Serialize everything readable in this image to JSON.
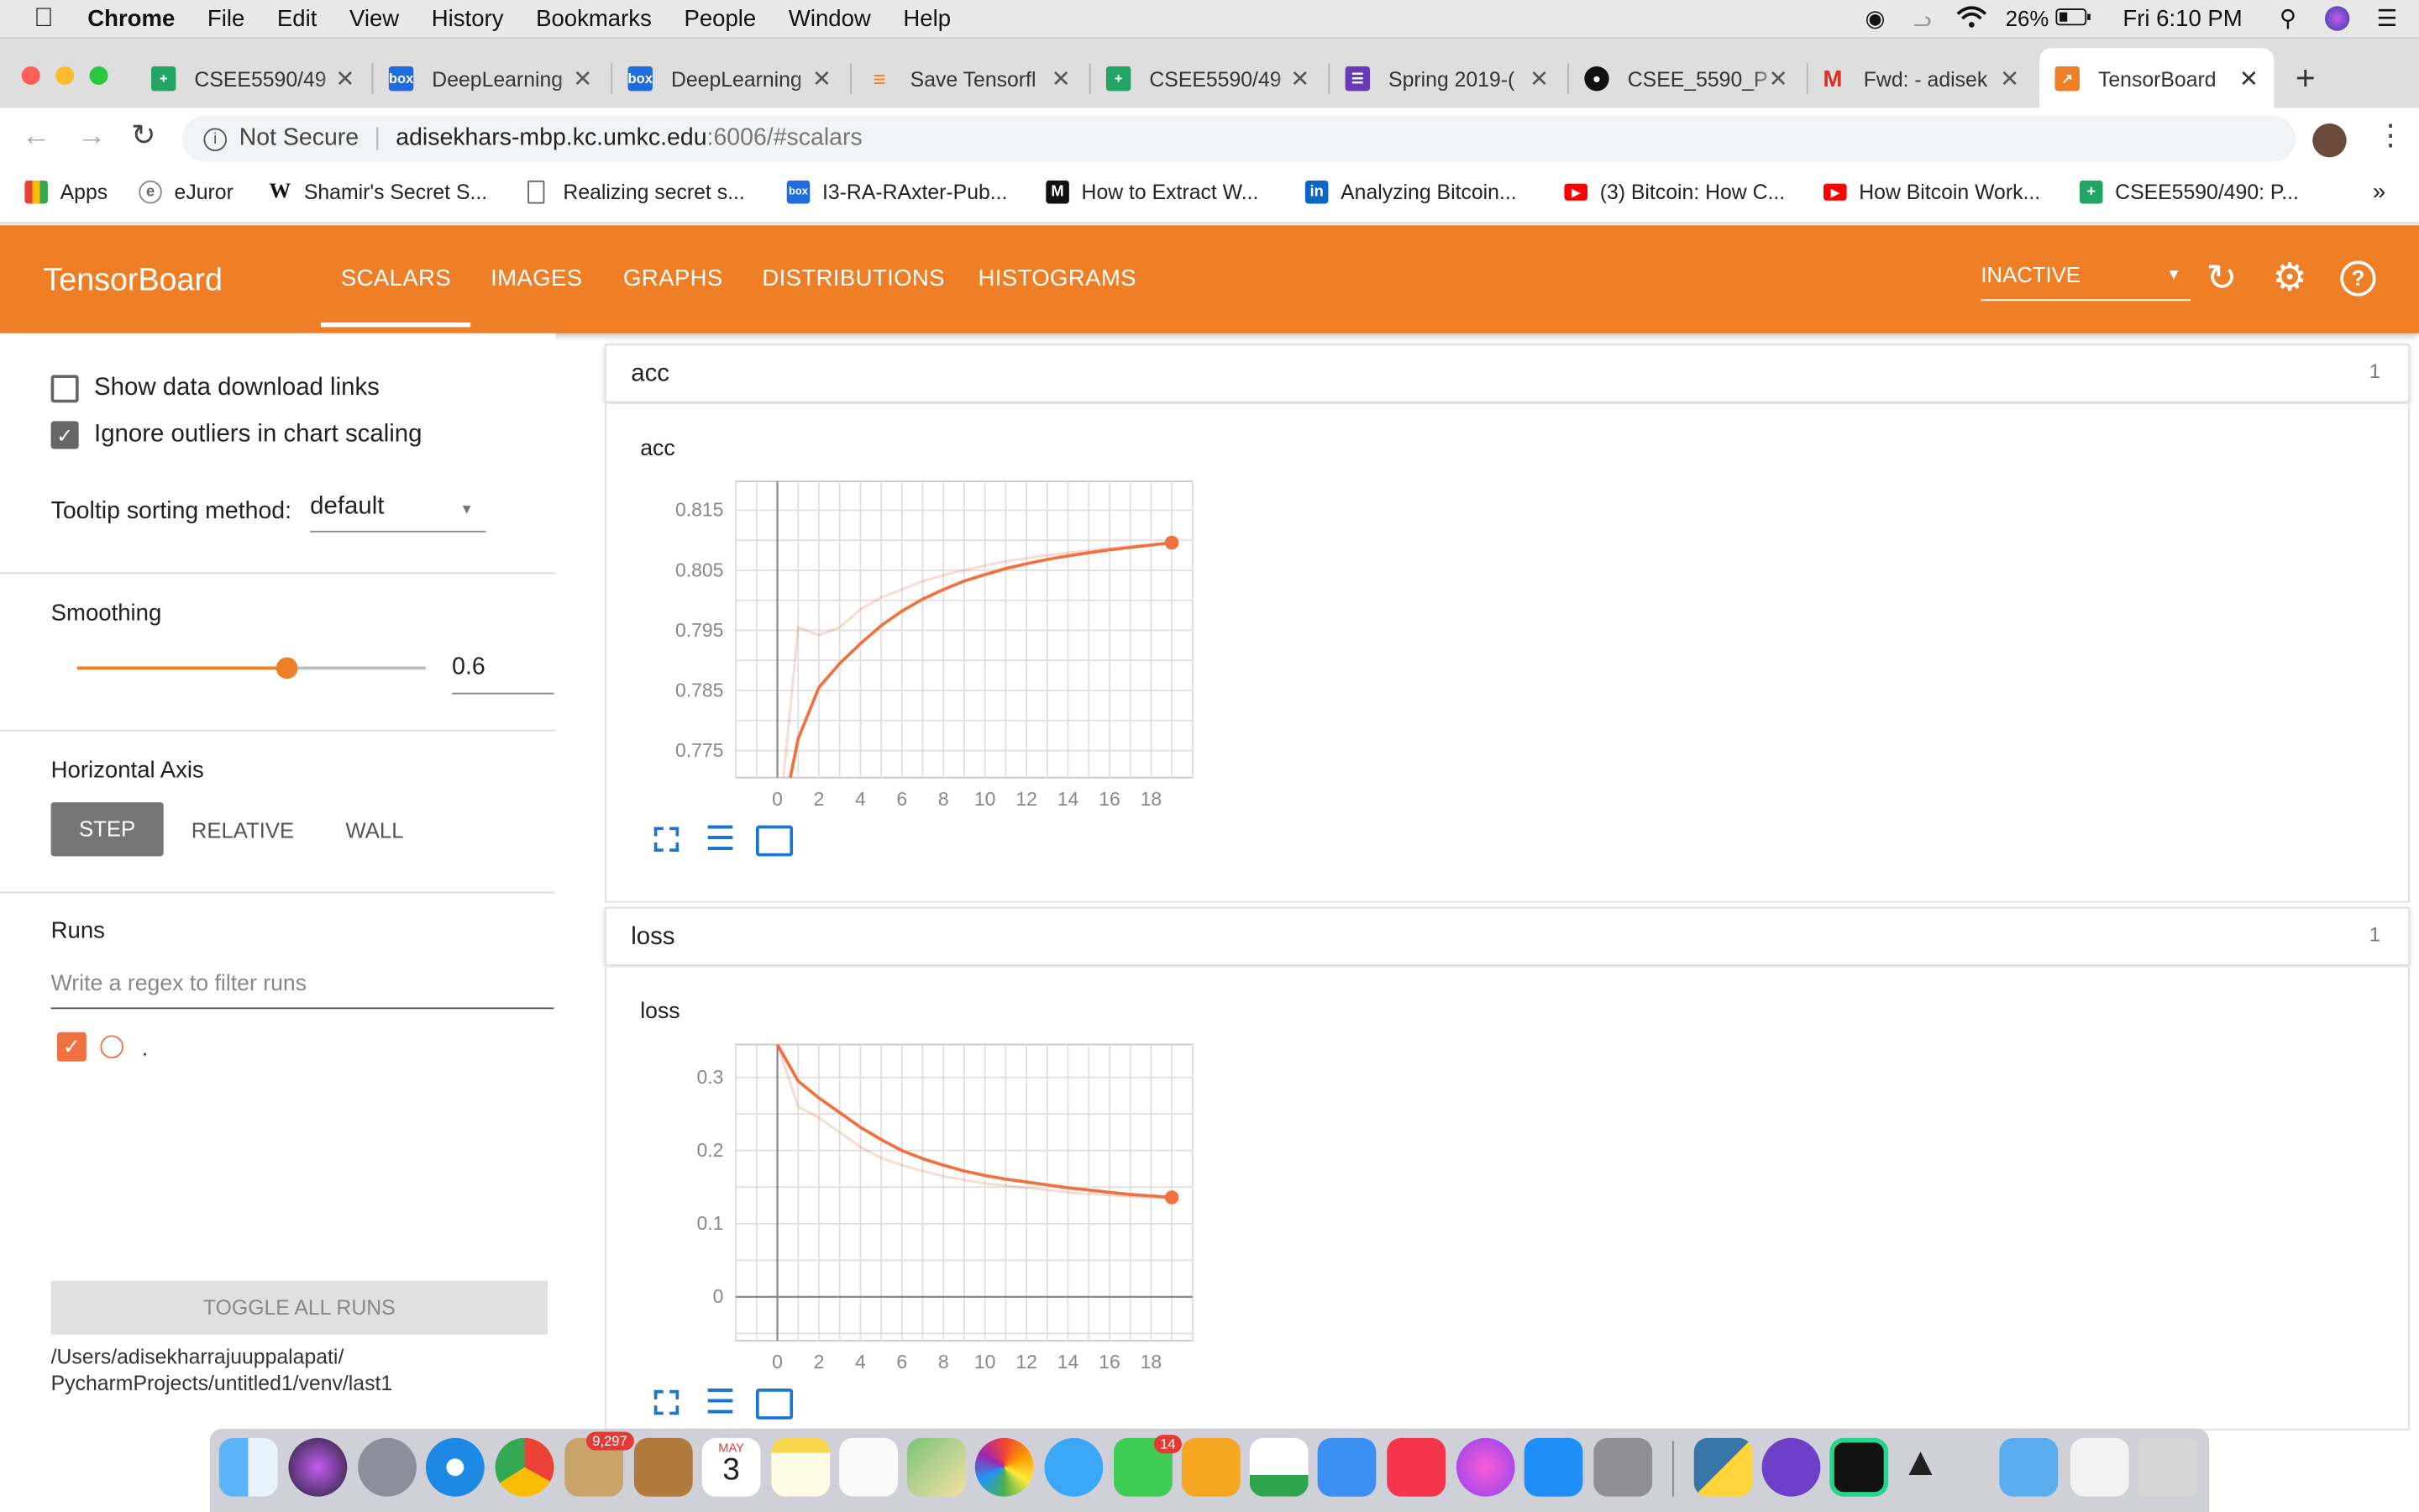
{
  "menubar": {
    "app": "Chrome",
    "items": [
      "File",
      "Edit",
      "View",
      "History",
      "Bookmarks",
      "People",
      "Window",
      "Help"
    ],
    "battery": "26%",
    "clock": "Fri 6:10 PM"
  },
  "tabs": [
    {
      "title": "CSEE5590/49",
      "icon": "sheets-icon"
    },
    {
      "title": "DeepLearning",
      "icon": "box-icon"
    },
    {
      "title": "DeepLearning",
      "icon": "box-icon"
    },
    {
      "title": "Save Tensorfl",
      "icon": "stackoverflow-icon"
    },
    {
      "title": "CSEE5590/49",
      "icon": "sheets-icon"
    },
    {
      "title": "Spring 2019-(",
      "icon": "forms-icon"
    },
    {
      "title": "CSEE_5590_P",
      "icon": "github-icon"
    },
    {
      "title": "Fwd: - adisek",
      "icon": "gmail-icon"
    },
    {
      "title": "TensorBoard",
      "icon": "tensorboard-icon"
    }
  ],
  "omnibox": {
    "security": "Not Secure",
    "url_host": "adisekhars-mbp.kc.umkc.edu",
    "url_rest": ":6006/#scalars"
  },
  "bookmarks": [
    "Apps",
    "eJuror",
    "Shamir's Secret S...",
    "Realizing secret s...",
    "I3-RA-RAxter-Pub...",
    "How to Extract W...",
    "Analyzing Bitcoin...",
    "(3) Bitcoin: How C...",
    "How Bitcoin Work...",
    "CSEE5590/490: P..."
  ],
  "tensorboard": {
    "title": "TensorBoard",
    "nav": [
      "SCALARS",
      "IMAGES",
      "GRAPHS",
      "DISTRIBUTIONS",
      "HISTOGRAMS"
    ],
    "status": "INACTIVE"
  },
  "sidebar": {
    "show_download": "Show data download links",
    "ignore_outliers": "Ignore outliers in chart scaling",
    "tooltip_label": "Tooltip sorting method:",
    "tooltip_value": "default",
    "smoothing_label": "Smoothing",
    "smoothing_value": "0.6",
    "smoothing_fraction": 0.6,
    "haxis_label": "Horizontal Axis",
    "haxis_options": [
      "STEP",
      "RELATIVE",
      "WALL"
    ],
    "runs_label": "Runs",
    "runs_filter_placeholder": "Write a regex to filter runs",
    "run_name": ".",
    "toggle_all": "TOGGLE ALL RUNS",
    "logdir": "/Users/adisekharrajuuppalapati/ PycharmProjects/untitled1/venv/last1"
  },
  "cards": [
    {
      "header": "acc",
      "count": "1",
      "chart_title": "acc"
    },
    {
      "header": "loss",
      "count": "1",
      "chart_title": "loss"
    }
  ],
  "colors": {
    "brand": "#ef7f27",
    "line": "#f0703f"
  },
  "chart_data": [
    {
      "type": "line",
      "title": "acc",
      "x_ticks": [
        0,
        2,
        4,
        6,
        8,
        10,
        12,
        14,
        16,
        18
      ],
      "y_ticks": [
        "0.775",
        "0.785",
        "0.795",
        "0.805",
        "0.815"
      ],
      "xlim": [
        -2,
        20
      ],
      "ylim": [
        0.7705,
        0.8198
      ],
      "smoothed": {
        "x": [
          0,
          1,
          2,
          3,
          4,
          5,
          6,
          7,
          8,
          9,
          10,
          11,
          12,
          13,
          14,
          15,
          16,
          17,
          18,
          19
        ],
        "y": [
          0.76,
          0.777,
          0.7855,
          0.7895,
          0.7928,
          0.7958,
          0.7982,
          0.8002,
          0.8018,
          0.8032,
          0.8043,
          0.8053,
          0.8061,
          0.8068,
          0.8074,
          0.8079,
          0.8084,
          0.8088,
          0.8092,
          0.8096
        ]
      },
      "raw": {
        "x": [
          0,
          1,
          2,
          3,
          4,
          5,
          6,
          7,
          8,
          9,
          10,
          11,
          12,
          13,
          14,
          15,
          16,
          17,
          18,
          19
        ],
        "y": [
          0.76,
          0.7955,
          0.7942,
          0.7955,
          0.7985,
          0.8005,
          0.8018,
          0.8032,
          0.8042,
          0.805,
          0.8058,
          0.8065,
          0.807,
          0.8075,
          0.8079,
          0.8083,
          0.8087,
          0.809,
          0.8093,
          0.8096
        ]
      },
      "grid": true
    },
    {
      "type": "line",
      "title": "loss",
      "x_ticks": [
        0,
        2,
        4,
        6,
        8,
        10,
        12,
        14,
        16,
        18
      ],
      "y_ticks": [
        "0",
        "0.1",
        "0.2",
        "0.3"
      ],
      "xlim": [
        -2,
        20
      ],
      "ylim": [
        -0.06,
        0.345
      ],
      "smoothed": {
        "x": [
          0,
          1,
          2,
          3,
          4,
          5,
          6,
          7,
          8,
          9,
          10,
          11,
          12,
          13,
          14,
          15,
          16,
          17,
          18,
          19
        ],
        "y": [
          0.345,
          0.295,
          0.272,
          0.252,
          0.232,
          0.215,
          0.2,
          0.189,
          0.18,
          0.172,
          0.166,
          0.161,
          0.157,
          0.153,
          0.149,
          0.146,
          0.143,
          0.14,
          0.138,
          0.136
        ]
      },
      "raw": {
        "x": [
          0,
          1,
          2,
          3,
          4,
          5,
          6,
          7,
          8,
          9,
          10,
          11,
          12,
          13,
          14,
          15,
          16,
          17,
          18,
          19
        ],
        "y": [
          0.345,
          0.26,
          0.245,
          0.225,
          0.205,
          0.19,
          0.18,
          0.172,
          0.165,
          0.16,
          0.155,
          0.152,
          0.149,
          0.146,
          0.143,
          0.141,
          0.139,
          0.137,
          0.136,
          0.135
        ]
      },
      "grid": true
    }
  ],
  "dock": {
    "mail_badge": "9,297",
    "facetime_badge": "14",
    "calendar_month": "MAY",
    "calendar_day": "3"
  }
}
